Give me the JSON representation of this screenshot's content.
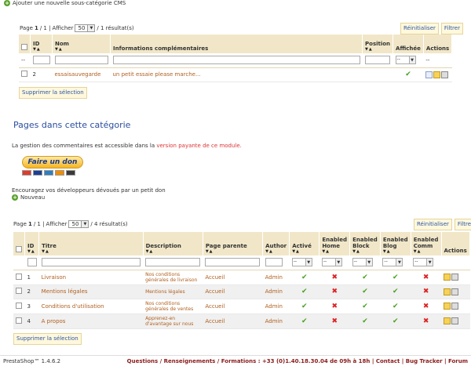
{
  "add_subcategory": "Ajouter une nouvelle sous-catégorie CMS",
  "table1": {
    "pager": {
      "prefix": "Page",
      "page": "1",
      "sep": "/ 1 |",
      "afficher": "Afficher",
      "per_page": "50",
      "result": "/ 1 résultat(s)"
    },
    "reset_label": "Réinitialiser",
    "filter_label": "Filtrer",
    "headers": {
      "id": "ID",
      "nom": "Nom",
      "info": "Informations complémentaires",
      "position": "Position",
      "affichee": "Affichée",
      "actions": "Actions"
    },
    "filter_dash": "--",
    "filter_sel": "--",
    "rows": [
      {
        "id": "2",
        "nom": "essaisauvegarde",
        "info": "un petit essaie please marche...",
        "affichee": "yes"
      }
    ],
    "delete_selection": "Supprimer la sélection"
  },
  "section_title": "Pages dans cette catégorie",
  "info_prefix": "La gestion des commentaires est accessible dans la ",
  "info_link": "version payante de ce module.",
  "donate_label": "Faire un don",
  "encourage": "Encouragez vos développeurs dévoués par un petit don",
  "nouveau": "Nouveau",
  "table2": {
    "pager": {
      "prefix": "Page",
      "page": "1",
      "sep": "/ 1 |",
      "afficher": "Afficher",
      "per_page": "50",
      "result": "/ 4 résultat(s)"
    },
    "reset_label": "Réinitialiser",
    "filter_label": "Filtrer",
    "headers": {
      "id": "ID",
      "titre": "Titre",
      "description": "Description",
      "parent": "Page parente",
      "author": "Author",
      "active": "Activé",
      "home": "Enabled Home",
      "block": "Enabled Block",
      "blog": "Enabled Blog",
      "comm": "Enabled Comm",
      "actions": "Actions"
    },
    "filter_sel": "--",
    "rows": [
      {
        "id": "1",
        "titre": "Livraison",
        "description": "Nos conditions générales de livraison",
        "parent": "Accueil",
        "author": "Admin",
        "active": "yes",
        "home": "no",
        "block": "yes",
        "blog": "yes",
        "comm": "no"
      },
      {
        "id": "2",
        "titre": "Mentions légales",
        "description": "Mentions légales",
        "parent": "Accueil",
        "author": "Admin",
        "active": "yes",
        "home": "no",
        "block": "yes",
        "blog": "yes",
        "comm": "no"
      },
      {
        "id": "3",
        "titre": "Conditions d'utilisation",
        "description": "Nos conditions générales de ventes",
        "parent": "Accueil",
        "author": "Admin",
        "active": "yes",
        "home": "no",
        "block": "yes",
        "blog": "yes",
        "comm": "no"
      },
      {
        "id": "4",
        "titre": "A propos",
        "description": "Apprenez-en d'avantage sur nous",
        "parent": "Accueil",
        "author": "Admin",
        "active": "yes",
        "home": "no",
        "block": "yes",
        "blog": "yes",
        "comm": "no"
      }
    ],
    "delete_selection": "Supprimer la sélection"
  },
  "footer": {
    "brand": "PrestaShop™ 1.4.6.2",
    "links": "Questions / Renseignements / Formations : +33 (0)1.40.18.30.04 de 09h à 18h | Contact | Bug Tracker | Forum"
  },
  "icons": {
    "ok": "check-icon",
    "no": "cross-icon"
  }
}
